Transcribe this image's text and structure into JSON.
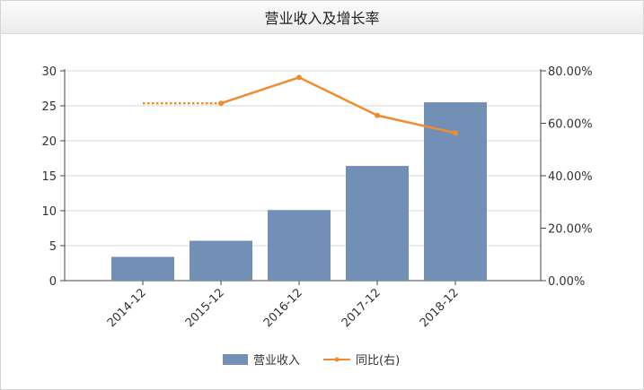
{
  "chart_data": {
    "type": "bar",
    "title": "营业收入及增长率",
    "categories": [
      "2014-12",
      "2015-12",
      "2016-12",
      "2017-12",
      "2018-12"
    ],
    "series": [
      {
        "name": "营业收入",
        "type": "bar",
        "axis": "left",
        "color": "#7290b6",
        "values": [
          3.4,
          5.7,
          10.1,
          16.4,
          25.5
        ]
      },
      {
        "name": "同比(右)",
        "type": "line",
        "axis": "right",
        "color": "#f28a2e",
        "values": [
          67.6,
          67.6,
          77.5,
          63.0,
          56.3
        ],
        "dashed_segments": [
          0
        ]
      }
    ],
    "y_left": {
      "lim": [
        0,
        30
      ],
      "ticks": [
        "0",
        "5",
        "10",
        "15",
        "20",
        "25",
        "30"
      ]
    },
    "y_right": {
      "lim": [
        0,
        80
      ],
      "ticks": [
        "0.00%",
        "20.00%",
        "40.00%",
        "60.00%",
        "80.00%"
      ]
    },
    "xlabel": "",
    "ylabel": "",
    "grid": true,
    "legend": "bottom-center"
  }
}
